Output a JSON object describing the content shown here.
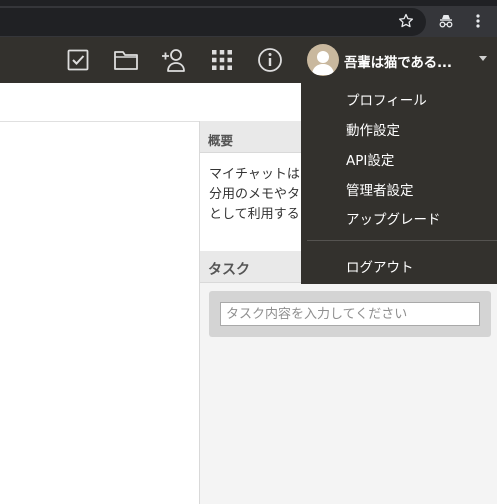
{
  "app": {
    "user_name": "吾輩は猫である..."
  },
  "user_menu": {
    "items": [
      {
        "label": "プロフィール"
      },
      {
        "label": "動作設定"
      },
      {
        "label": "API設定"
      },
      {
        "label": "管理者設定"
      },
      {
        "label": "アップグレード"
      }
    ],
    "logout_label": "ログアウト"
  },
  "summary": {
    "title": "概要",
    "lines": [
      "マイチャットは",
      "分用のメモやタ",
      "として利用する"
    ]
  },
  "tasks": {
    "title": "タスク",
    "input_placeholder": "タスク内容を入力してください"
  },
  "colors": {
    "header_bg": "#33312d",
    "menu_text": "#ffffff",
    "panel_bg": "#f4f4f4"
  }
}
